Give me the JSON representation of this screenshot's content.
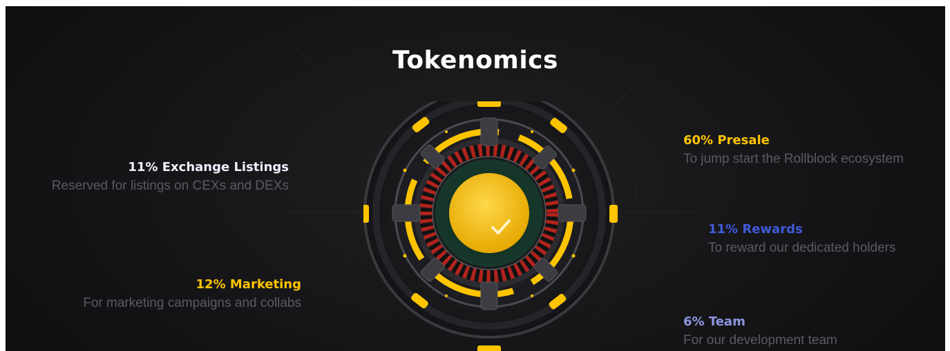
{
  "title": "Tokenomics",
  "colors": {
    "background": "#151517",
    "accent_yellow": "#ffc400",
    "accent_blue": "#3f5bd8",
    "accent_periwinkle": "#8e95e0",
    "text_white": "#ffffff",
    "description_gray": "#5a5b63"
  },
  "allocations": {
    "exchange": {
      "label": "11% Exchange Listings",
      "description": "Reserved for listings on CEXs and DEXs",
      "color": "#eef0ff"
    },
    "marketing": {
      "label": "12% Marketing",
      "description": "For marketing campaigns and collabs",
      "color": "#ffc400"
    },
    "presale": {
      "label": "60% Presale",
      "description": "To jump start the Rollblock ecosystem",
      "color": "#ffc400"
    },
    "rewards": {
      "label": "11% Rewards",
      "description": "To reward our dedicated holders",
      "color": "#3f5bd8"
    },
    "team": {
      "label": "6% Team",
      "description": "For our development team",
      "color": "#8e95e0"
    }
  },
  "center_graphic": {
    "icon": "checkmark-icon"
  }
}
